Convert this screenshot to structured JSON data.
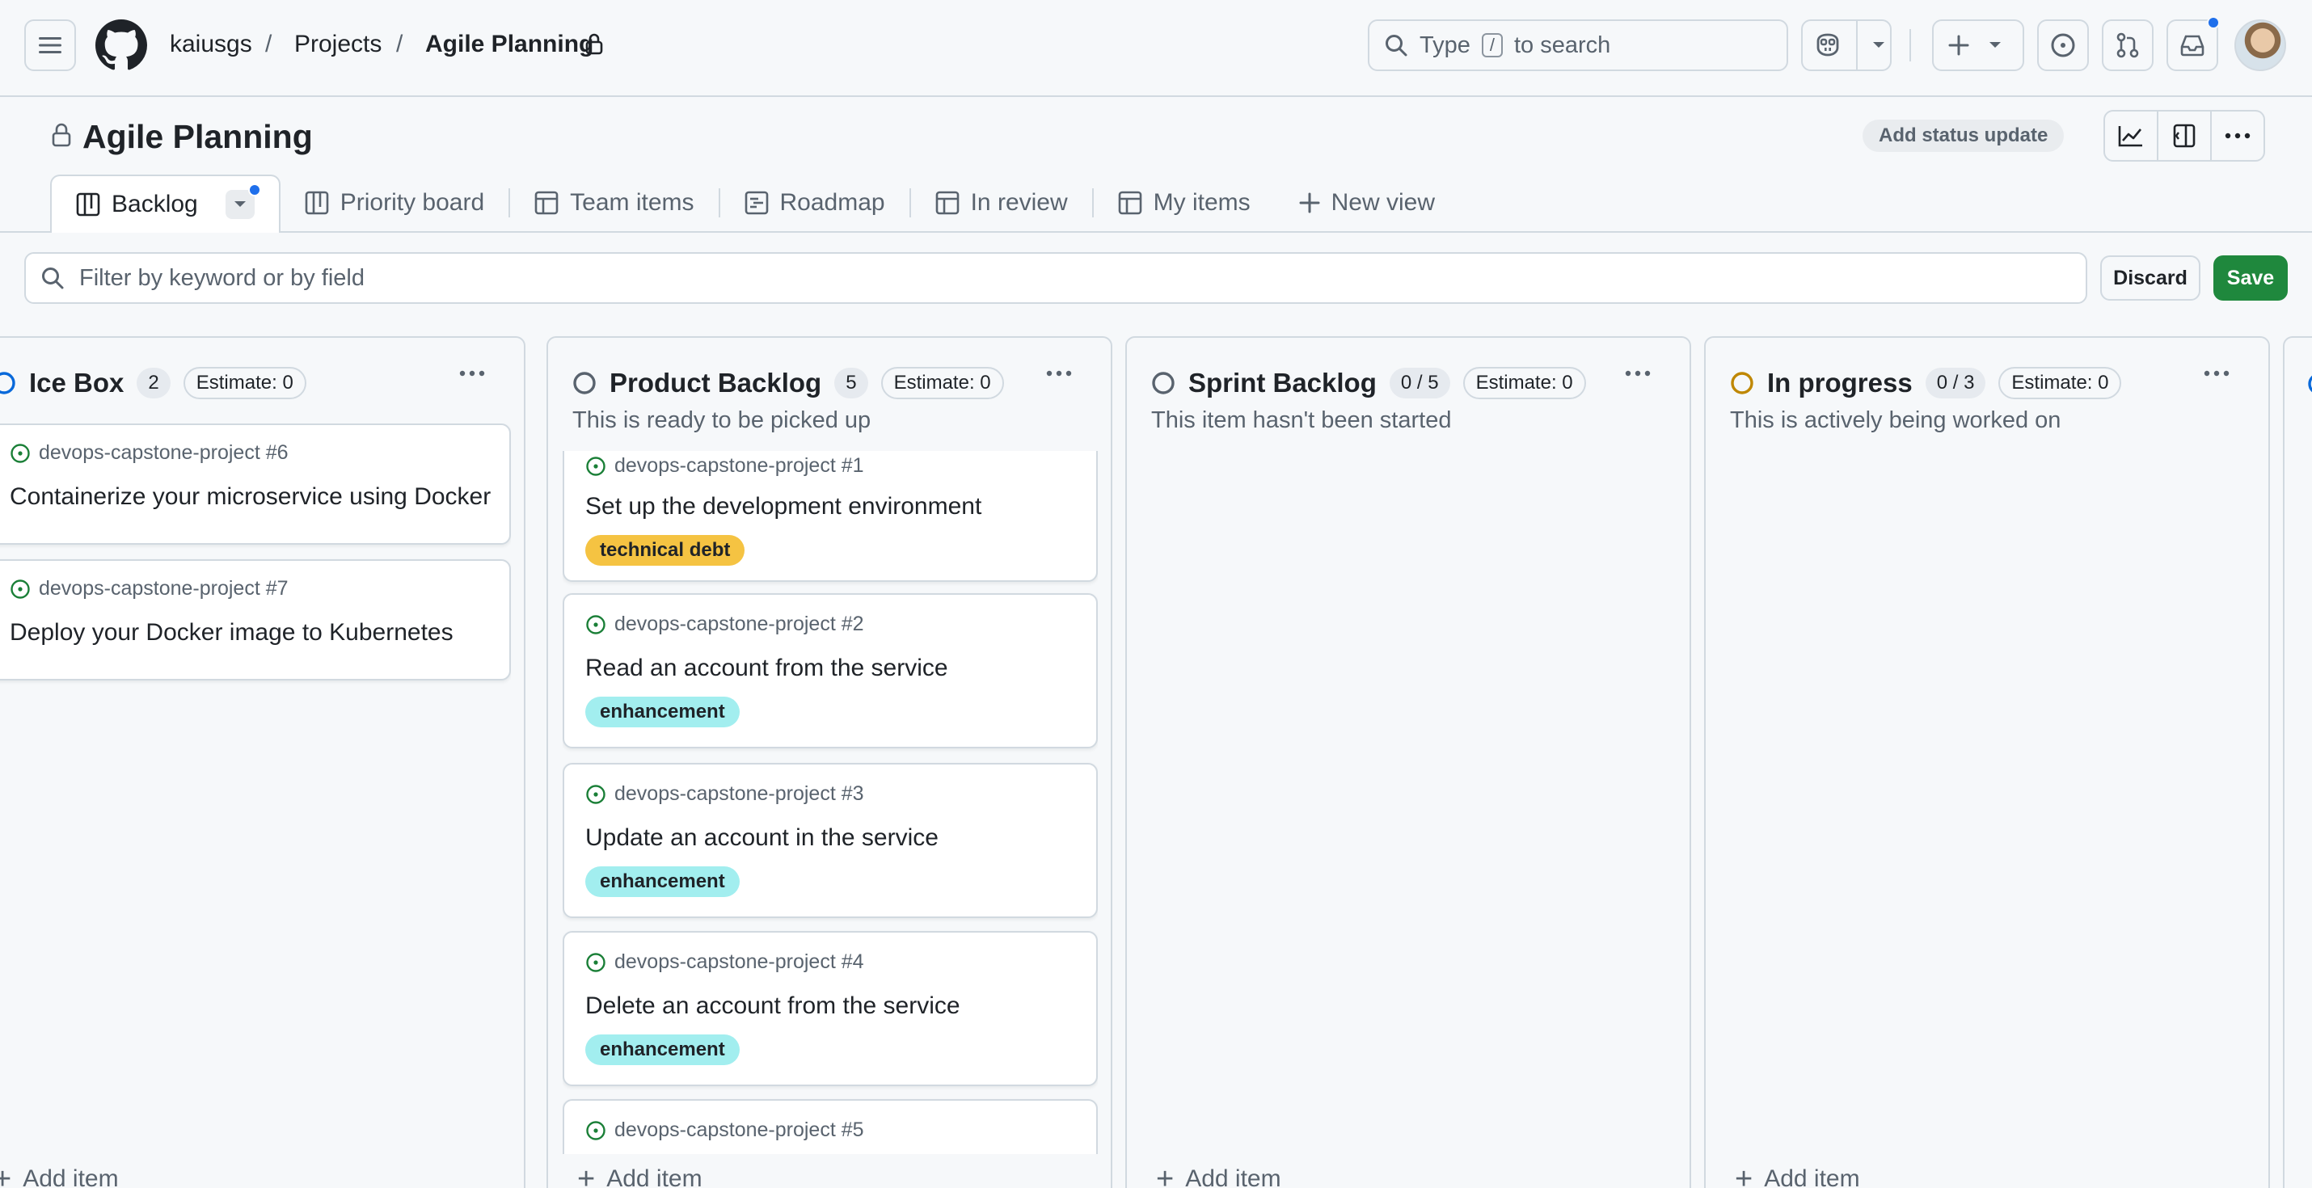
{
  "header": {
    "breadcrumbs": [
      "kaiusgs",
      "Projects",
      "Agile Planning"
    ],
    "separator": "/",
    "search": {
      "prefix": "Type",
      "key": "/",
      "suffix": "to search"
    }
  },
  "project": {
    "title": "Agile Planning",
    "status_update_label": "Add status update"
  },
  "tabs": [
    {
      "label": "Backlog",
      "icon": "board-icon",
      "active": true
    },
    {
      "label": "Priority board",
      "icon": "board-icon"
    },
    {
      "label": "Team items",
      "icon": "table-icon"
    },
    {
      "label": "Roadmap",
      "icon": "roadmap-icon"
    },
    {
      "label": "In review",
      "icon": "table-icon"
    },
    {
      "label": "My items",
      "icon": "table-icon"
    }
  ],
  "new_view_label": "New view",
  "filter": {
    "placeholder": "Filter by keyword or by field",
    "discard_label": "Discard",
    "save_label": "Save"
  },
  "colors": {
    "accent": "#1f6feb",
    "save": "#1f883d",
    "open_issue": "#1a7f37",
    "technical_debt": "#f5c342",
    "enhancement": "#a2eeef",
    "icebox_status": "#0969da",
    "backlog_status": "#59636e",
    "in_progress_status": "#bf8700"
  },
  "add_item_label": "Add item",
  "columns": [
    {
      "id": "icebox",
      "title": "Ice Box",
      "count": "2",
      "estimate": "Estimate: 0",
      "description": "",
      "cards": [
        {
          "repo": "devops-capstone-project #6",
          "title": "Containerize your microservice using Docker"
        },
        {
          "repo": "devops-capstone-project #7",
          "title": "Deploy your Docker image to Kubernetes"
        }
      ]
    },
    {
      "id": "product-backlog",
      "title": "Product Backlog",
      "count": "5",
      "estimate": "Estimate: 0",
      "description": "This is ready to be picked up",
      "cards": [
        {
          "repo": "devops-capstone-project #1",
          "title": "Set up the development environment",
          "label": "technical debt"
        },
        {
          "repo": "devops-capstone-project #2",
          "title": "Read an account from the service",
          "label": "enhancement"
        },
        {
          "repo": "devops-capstone-project #3",
          "title": "Update an account in the service",
          "label": "enhancement"
        },
        {
          "repo": "devops-capstone-project #4",
          "title": "Delete an account from the service",
          "label": "enhancement"
        },
        {
          "repo": "devops-capstone-project #5",
          "title": ""
        }
      ]
    },
    {
      "id": "sprint-backlog",
      "title": "Sprint Backlog",
      "count": "0 / 5",
      "estimate": "Estimate: 0",
      "description": "This item hasn't been started",
      "cards": []
    },
    {
      "id": "in-progress",
      "title": "In progress",
      "count": "0 / 3",
      "estimate": "Estimate: 0",
      "description": "This is actively being worked on",
      "cards": []
    }
  ]
}
